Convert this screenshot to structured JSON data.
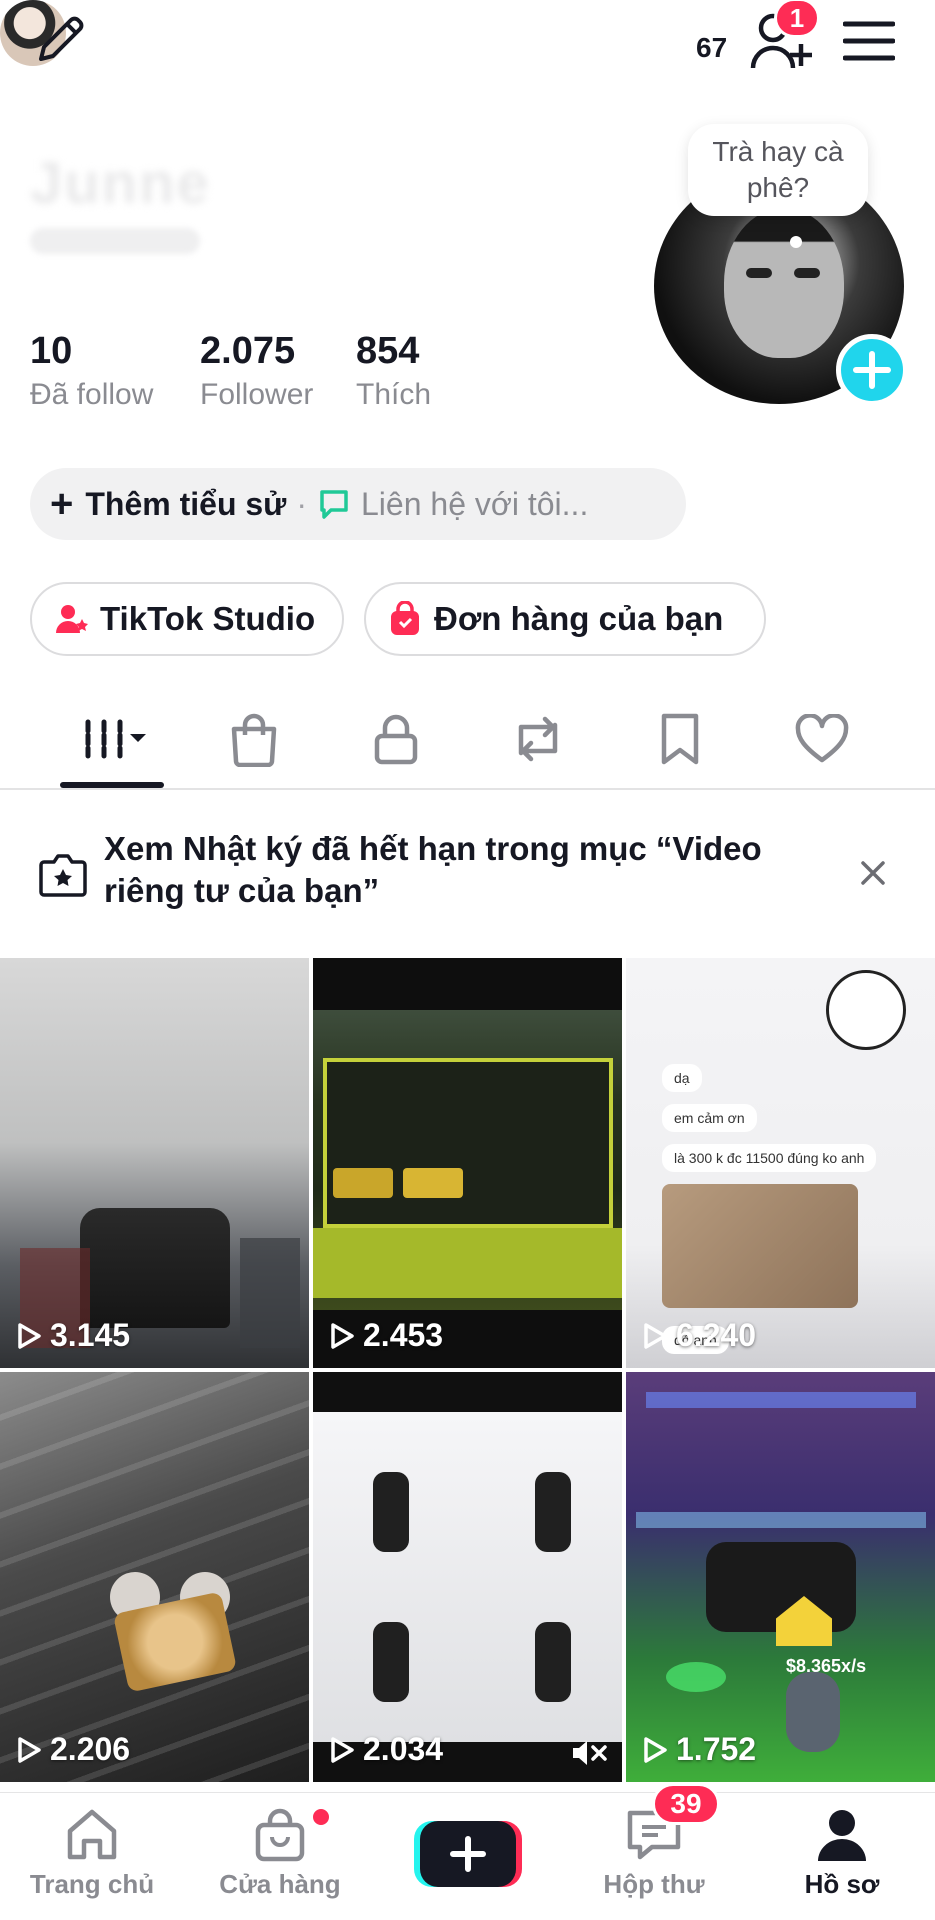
{
  "topbar": {
    "story_count": "67",
    "friend_requests_badge": "1"
  },
  "profile": {
    "bubble_text": "Trà hay cà phê?",
    "stats": [
      {
        "value": "10",
        "label": "Đã follow"
      },
      {
        "value": "2.075",
        "label": "Follower"
      },
      {
        "value": "854",
        "label": "Thích"
      }
    ],
    "bio_add": "Thêm tiểu sử",
    "bio_separator": "·",
    "contact": "Liên hệ với tôi..."
  },
  "actions": {
    "studio_label": "TikTok Studio",
    "orders_label": "Đơn hàng của bạn"
  },
  "banner": {
    "text": "Xem Nhật ký đã hết hạn trong mục “Video riêng tư của bạn”"
  },
  "videos": [
    {
      "views": "3.145"
    },
    {
      "views": "2.453"
    },
    {
      "views": "6.240"
    },
    {
      "views": "2.206"
    },
    {
      "views": "2.034"
    },
    {
      "views": "1.752"
    }
  ],
  "tile_texts": {
    "chat_1": "dạ",
    "chat_2": "em cảm ơn",
    "chat_3": "là 300 k đc 11500 đúng ko anh",
    "chat_4": "đó anh",
    "money": "$8.365x/s"
  },
  "bottom_nav": {
    "home": "Trang chủ",
    "shop": "Cửa hàng",
    "inbox": "Hộp thư",
    "inbox_badge": "39",
    "profile": "Hồ sơ"
  },
  "colors": {
    "accent_red": "#fe2c55",
    "accent_cyan": "#20d5ec",
    "text_primary": "#161823",
    "text_secondary": "#8a8b91"
  }
}
